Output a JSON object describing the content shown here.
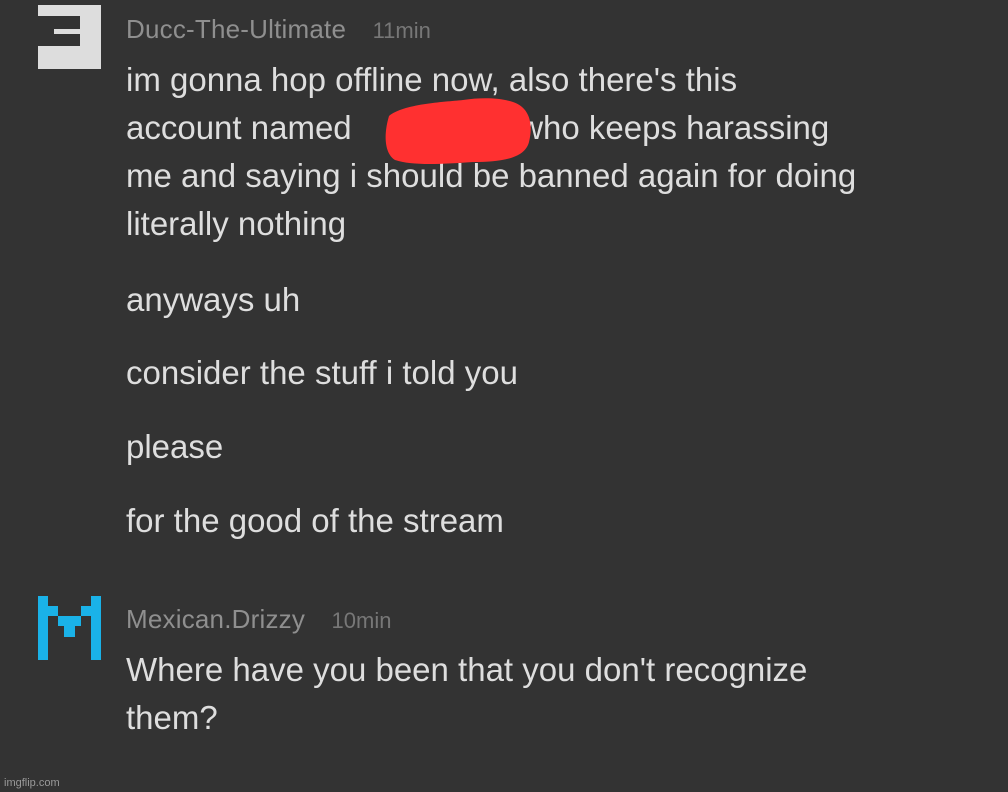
{
  "comments": [
    {
      "username": "Ducc-The-Ultimate",
      "time": "11min",
      "avatar": "white-block-pixel-avatar",
      "lines": [
        "im gonna hop offline now, also there's this",
        "account named                \" who keeps harassing",
        "me and saying i should be banned again for doing",
        "literally nothing"
      ],
      "followups": [
        "anyways uh",
        "consider the stuff i told you",
        "please",
        "for the good of the stream"
      ]
    },
    {
      "username": "Mexican.Drizzy",
      "time": "10min",
      "avatar": "blue-m-pixel-avatar",
      "lines": [
        "Where have you been that you don't recognize",
        "them?"
      ]
    }
  ],
  "watermark": "imgflip.com",
  "colors": {
    "background": "#333333",
    "username": "#8f8f8f",
    "text": "#dedede",
    "avatar1": "#dddddd",
    "avatar2": "#1ab2e8",
    "redaction": "#ff3030"
  }
}
